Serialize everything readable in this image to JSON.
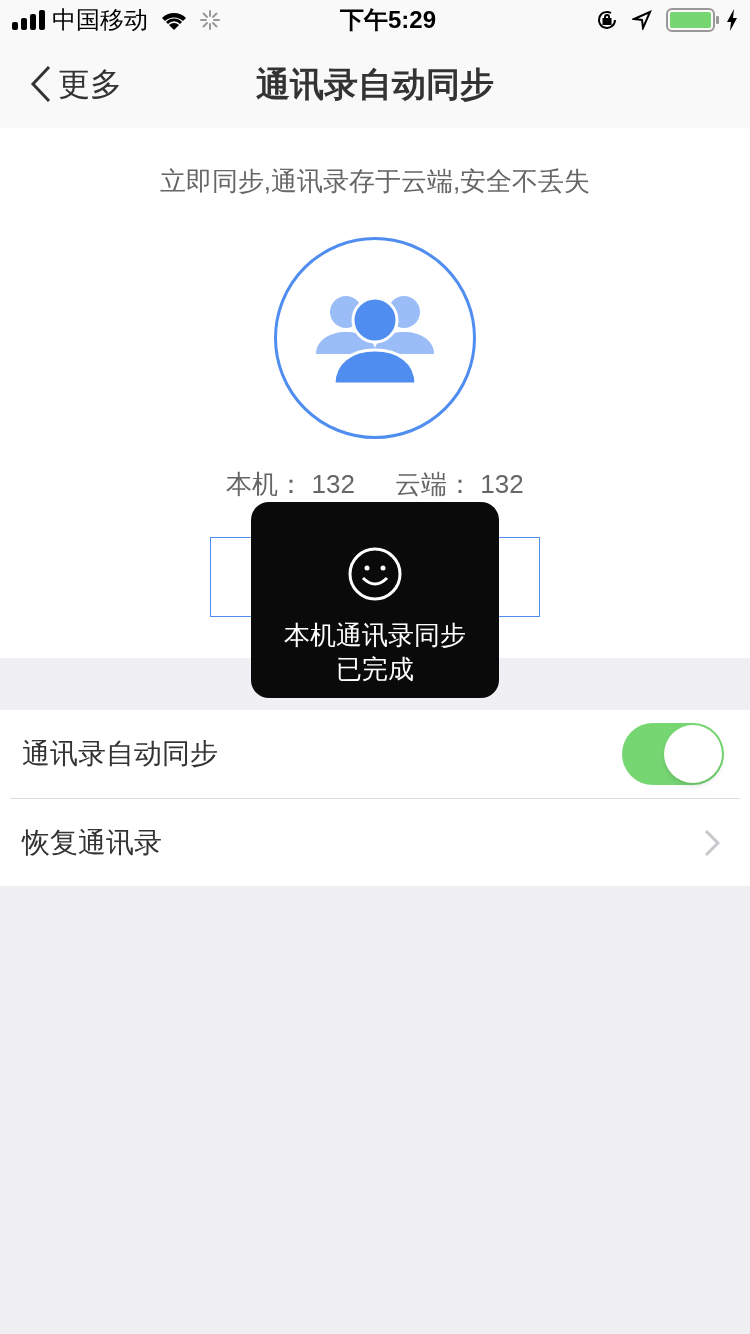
{
  "status_bar": {
    "carrier": "中国移动",
    "time": "下午5:29"
  },
  "nav": {
    "back": "更多",
    "title": "通讯录自动同步"
  },
  "intro": "立即同步,通讯录存于云端,安全不丢失",
  "counts": [
    {
      "label": "本机：",
      "value": "132"
    },
    {
      "label": "云端：",
      "value": "132"
    }
  ],
  "sync_button": {
    "label_hidden": true
  },
  "toast": {
    "lines": [
      "本机通讯录同步",
      "已完成"
    ]
  },
  "settings": [
    {
      "kind": "toggle",
      "label": "通讯录自动同步",
      "on": true
    },
    {
      "kind": "link",
      "label": "恢复通讯录"
    }
  ]
}
